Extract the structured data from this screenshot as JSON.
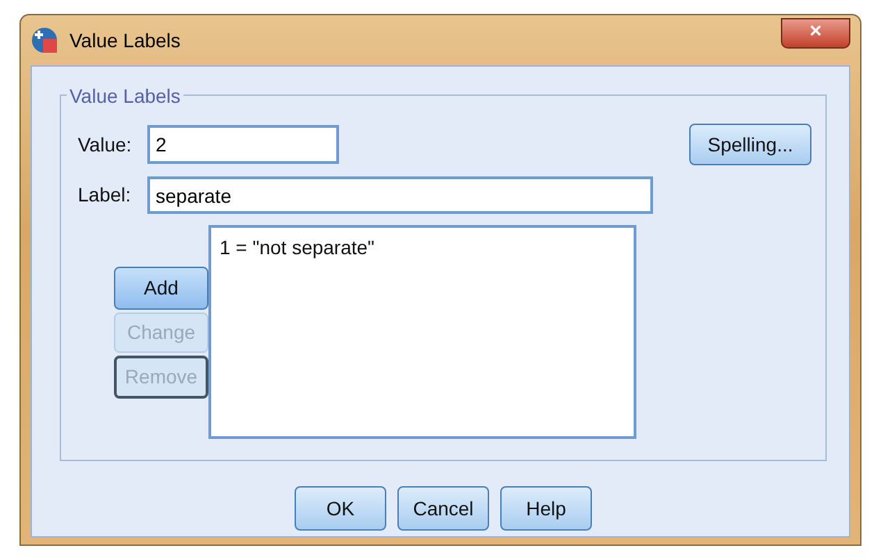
{
  "window": {
    "title": "Value Labels",
    "close": "×"
  },
  "group": {
    "title": "Value Labels"
  },
  "value_field": {
    "label": "Value:",
    "value": "2"
  },
  "label_field": {
    "label": "Label:",
    "value": "separate"
  },
  "spelling_button": "Spelling...",
  "side_buttons": [
    {
      "label": "Add",
      "default": true,
      "disabled": false,
      "focused": false
    },
    {
      "label": "Change",
      "default": false,
      "disabled": true,
      "focused": false
    },
    {
      "label": "Remove",
      "default": false,
      "disabled": true,
      "focused": true
    }
  ],
  "list_items": [
    {
      "text": "1 = \"not separate\"",
      "selected": false
    }
  ],
  "footer_buttons": [
    "OK",
    "Cancel",
    "Help"
  ]
}
